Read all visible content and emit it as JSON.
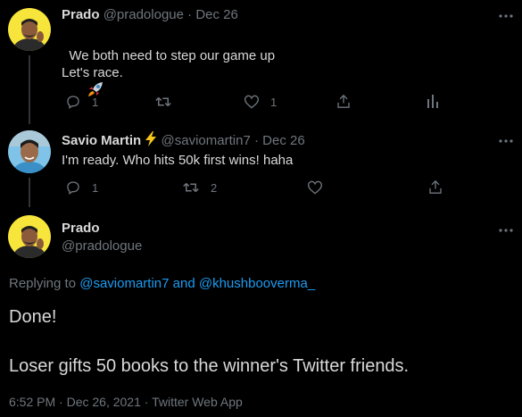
{
  "tweets": [
    {
      "name": "Prado",
      "handle": "@pradologue",
      "sep": "·",
      "date": "Dec 26",
      "text_line1": "We both need to step our game up",
      "text_emoji": "rocket-emoji",
      "text_line2": "Let's race.",
      "actions": {
        "reply_count": "1",
        "retweet_count": "",
        "like_count": "1"
      }
    },
    {
      "name": "Savio Martin",
      "handle": "@saviomartin7",
      "sep": "·",
      "date": "Dec 26",
      "name_emoji": "lightning-emoji",
      "text_line1": "I'm ready. Who hits 50k first wins! haha",
      "actions": {
        "reply_count": "1",
        "retweet_count": "2",
        "like_count": ""
      }
    }
  ],
  "main": {
    "name": "Prado",
    "handle": "@pradologue",
    "replying_prefix": "Replying to",
    "replying_user1": "@saviomartin7",
    "replying_and": "and",
    "replying_user2": "@khushbooverma_",
    "text_line1": "Done!",
    "text_line2": "Loser gifts 50 books to the winner's Twitter friends.",
    "time": "6:52 PM",
    "sep": "·",
    "date": "Dec 26, 2021",
    "source": "Twitter Web App"
  },
  "icons": {
    "more": "more-icon",
    "reply": "reply-icon",
    "retweet": "retweet-icon",
    "like": "like-icon",
    "share": "share-icon",
    "analytics": "analytics-icon"
  },
  "colors": {
    "background": "#000000",
    "text": "#d9d9d9",
    "muted": "#6e767d",
    "link": "#1d9bf0",
    "thread_line": "#2f3336",
    "avatar_bg": "#f7e53b",
    "lightning": "#f5c518"
  }
}
